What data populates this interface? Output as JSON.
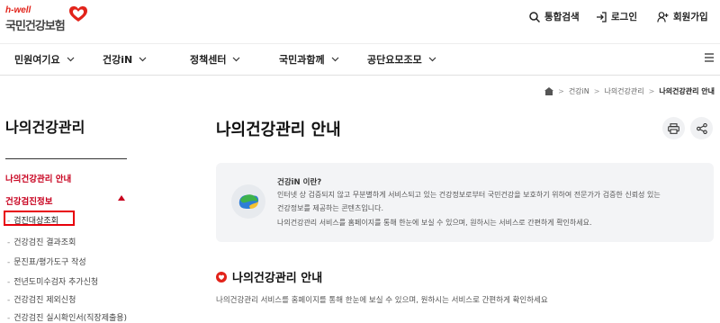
{
  "header": {
    "logo_tag": "h-well",
    "logo_name": "국민건강보험",
    "utils": {
      "search": "통합검색",
      "login": "로그인",
      "join": "회원가입"
    }
  },
  "gnb": [
    "민원여기요",
    "건강iN",
    "정책센터",
    "국민과함께",
    "공단요모조모"
  ],
  "breadcrumb": {
    "items": [
      "건강iN",
      "나의건강관리"
    ],
    "current": "나의건강관리 안내"
  },
  "sidebar": {
    "title": "나의건강관리",
    "lv1_a": "나의건강관리 안내",
    "lv1_b": "건강검진정보",
    "subs": [
      "검진대상조회",
      "건강검진 결과조회",
      "문진표/평가도구 작성",
      "전년도미수검자 추가신청",
      "건강검진 제외신청",
      "건강검진 실시확인서(직장제출용)"
    ]
  },
  "main": {
    "title": "나의건강관리 안내",
    "info": {
      "title": "건강iN 이란?",
      "line1": "인터넷 상 검증되지 않고 무분별하게 서비스되고 있는 건강정보로부터 국민건강을 보호하기 위하여 전문가가 검증한 신뢰성 있는",
      "line2": "건강정보를 제공하는 콘텐츠입니다.",
      "line3": "나의건강관리 서비스를 홈페이지를 통해 한눈에 보실 수 있으며, 원하시는 서비스로 간편하게 확인하세요."
    },
    "section_title": "나의건강관리 안내",
    "section_desc": "나의건강관리 서비스를 홈페이지를 통해 한눈에 보실 수 있으며, 원하시는 서비스로 간편하게 확인하세요"
  },
  "colors": {
    "brand_red": "#e2231a",
    "active_red": "#c8001e",
    "highlight_border": "#e8000b",
    "info_bg": "#f3f4f6"
  }
}
